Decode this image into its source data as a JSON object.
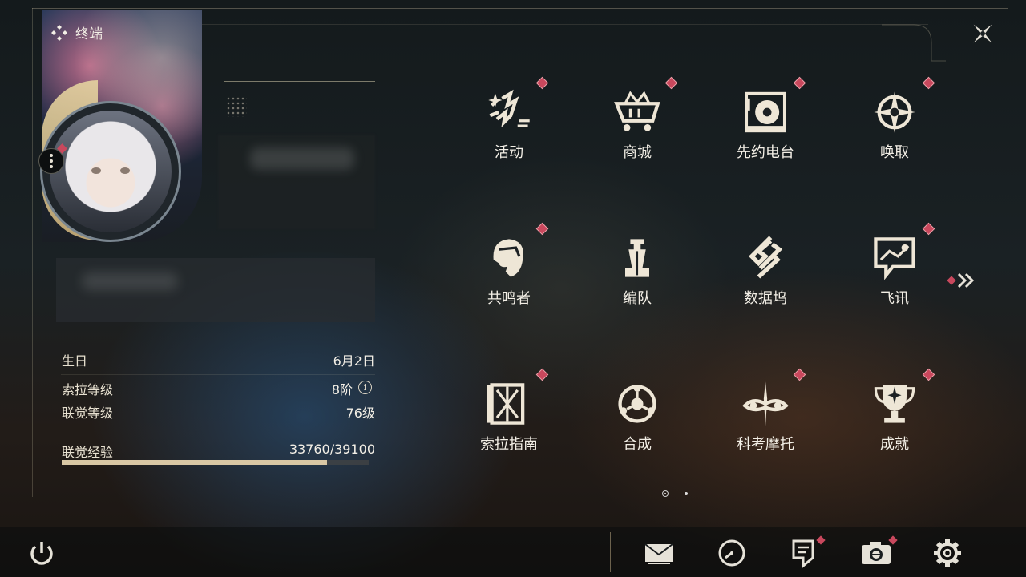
{
  "header": {
    "title": "终端",
    "title_icon": "four-diamond-icon",
    "close_icon": "close-star-icon"
  },
  "profile": {
    "avatar_alt": "avatar",
    "more_icon": "more-vertical-icon",
    "rows": [
      {
        "label": "生日",
        "value": "6月2日"
      },
      {
        "label": "索拉等级",
        "value": "8阶"
      },
      {
        "label": "联觉等级",
        "value": "76级"
      }
    ],
    "info_glyph": "i",
    "exp": {
      "label": "联觉经验",
      "value": "33760/39100",
      "current": 33760,
      "max": 39100
    }
  },
  "menu": {
    "page": 1,
    "pages": 2,
    "items": [
      {
        "label": "活动",
        "icon": "activity-sparkle-icon",
        "badge": true
      },
      {
        "label": "商城",
        "icon": "shop-cart-icon",
        "badge": true
      },
      {
        "label": "先约电台",
        "icon": "radio-disc-icon",
        "badge": true
      },
      {
        "label": "唤取",
        "icon": "compass-star-icon",
        "badge": true
      },
      {
        "label": "共鸣者",
        "icon": "resonator-head-icon",
        "badge": true
      },
      {
        "label": "编队",
        "icon": "chess-team-icon",
        "badge": false
      },
      {
        "label": "数据坞",
        "icon": "data-dock-icon",
        "badge": false
      },
      {
        "label": "飞讯",
        "icon": "message-chat-icon",
        "badge": true
      },
      {
        "label": "索拉指南",
        "icon": "guide-book-icon",
        "badge": true
      },
      {
        "label": "合成",
        "icon": "synthesis-icon",
        "badge": false
      },
      {
        "label": "科考摩托",
        "icon": "motorcycle-icon",
        "badge": true
      },
      {
        "label": "成就",
        "icon": "trophy-icon",
        "badge": true
      }
    ],
    "next_icon": "double-chevron-right-icon"
  },
  "bottom_bar": {
    "items": [
      {
        "icon": "power-icon"
      },
      {
        "icon": "mail-icon"
      },
      {
        "icon": "clock-gauge-icon"
      },
      {
        "icon": "notice-icon",
        "badge": true
      },
      {
        "icon": "camera-icon",
        "badge": true
      },
      {
        "icon": "settings-gear-icon"
      }
    ]
  },
  "colors": {
    "accent": "#c9485d",
    "text": "#f3efe6",
    "exp_fill": "#d9c7a4"
  }
}
